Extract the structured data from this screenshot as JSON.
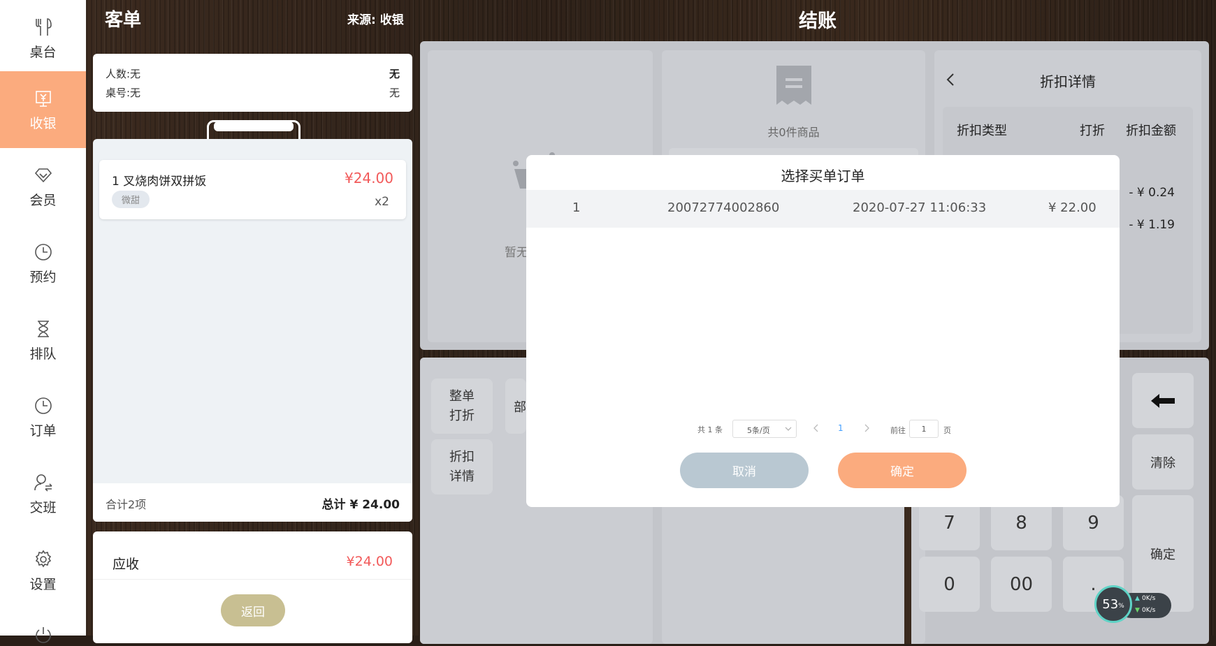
{
  "sidebar": {
    "items": [
      {
        "label": "桌台",
        "icon": "fork-knife-icon"
      },
      {
        "label": "收银",
        "icon": "cashier-icon",
        "active": true
      },
      {
        "label": "会员",
        "icon": "diamond-icon"
      },
      {
        "label": "预约",
        "icon": "clock-icon"
      },
      {
        "label": "排队",
        "icon": "hourglass-icon"
      },
      {
        "label": "订单",
        "icon": "clock-icon"
      },
      {
        "label": "交班",
        "icon": "user-switch-icon"
      },
      {
        "label": "设置",
        "icon": "gear-icon"
      }
    ]
  },
  "left_panel": {
    "title": "客单",
    "source": "来源: 收银",
    "info": {
      "people": "人数:无",
      "people_value": "无",
      "table": "桌号:无",
      "table_value": "无"
    },
    "order_item": {
      "name": "1 叉烧肉饼双拼饭",
      "price": "¥24.00",
      "tag": "微甜",
      "qty": "x2"
    },
    "summary": {
      "count": "合计2项",
      "total": "总计 ¥ 24.00"
    },
    "receivable": {
      "label": "应收",
      "value": "¥24.00"
    },
    "back_button": "返回"
  },
  "checkout": {
    "title": "结账",
    "empty_text": "暂无",
    "goods_count": "共0件商品",
    "discount_detail": {
      "title": "折扣详情",
      "headers": [
        "折扣类型",
        "打折",
        "折扣金额"
      ],
      "amounts": [
        "- ¥ 0.24",
        "- ¥ 1.19"
      ]
    },
    "buttons": {
      "whole_discount": [
        "整单",
        "打折"
      ],
      "discount_detail": [
        "折扣",
        "详情"
      ],
      "partial": "部"
    },
    "keypad": {
      "backspace": "←",
      "clear": "清除",
      "confirm": "确定",
      "keys": [
        "7",
        "8",
        "9",
        "0",
        "00",
        "."
      ]
    }
  },
  "modal": {
    "title": "选择买单订单",
    "row": {
      "index": "1",
      "order_no": "20072774002860",
      "time": "2020-07-27 11:06:33",
      "amount": "¥ 22.00"
    },
    "pagination": {
      "total": "共 1 条",
      "page_size": "5条/页",
      "current": "1",
      "goto_label": "前往",
      "goto_value": "1",
      "page_suffix": "页"
    },
    "cancel": "取消",
    "confirm": "确定"
  },
  "network_widget": {
    "percent": "53",
    "percent_unit": "%",
    "up": "0K/s",
    "down": "0K/s"
  },
  "colors": {
    "accent": "#fbab7e",
    "price_red": "#f25a5a",
    "cancel_btn": "#b9c8d2",
    "back_btn": "#c8bf92"
  }
}
